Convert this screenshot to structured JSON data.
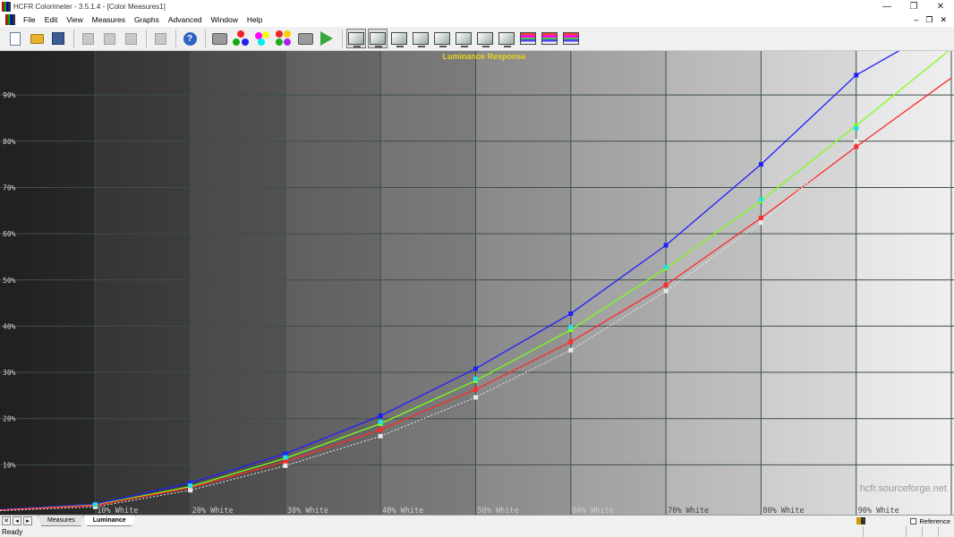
{
  "window": {
    "title": "HCFR Colorimeter - 3.5.1.4 - [Color Measures1]",
    "controls": {
      "minimize": "—",
      "restore": "❐",
      "close": "✕"
    }
  },
  "menu": {
    "items": [
      "File",
      "Edit",
      "View",
      "Measures",
      "Graphs",
      "Advanced",
      "Window",
      "Help"
    ],
    "mdi": {
      "minimize": "–",
      "restore": "❐",
      "close": "✕"
    }
  },
  "toolbar": {
    "help_glyph": "?"
  },
  "chart_data": {
    "type": "line",
    "title": "Luminance Response",
    "x": [
      0,
      10,
      20,
      30,
      40,
      50,
      60,
      70,
      80,
      90,
      100
    ],
    "xlim": [
      0,
      100
    ],
    "ylim": [
      0,
      100
    ],
    "x_tick_labels": [
      "10% White",
      "20% White",
      "30% White",
      "40% White",
      "50% White",
      "60% White",
      "70% White",
      "80% White",
      "90% White"
    ],
    "y_tick_labels": [
      "10%",
      "20%",
      "30%",
      "40%",
      "50%",
      "60%",
      "70%",
      "80%",
      "90%"
    ],
    "grid": true,
    "series": [
      {
        "color": "#1f1fff",
        "values": [
          0.3,
          1.5,
          6.1,
          12.4,
          20.6,
          30.8,
          42.7,
          57.5,
          75.0,
          94.3,
          106.0
        ]
      },
      {
        "color": "#7cff1a",
        "values": [
          0.2,
          1.3,
          5.3,
          11.4,
          18.9,
          28.2,
          39.2,
          52.5,
          67.1,
          83.4,
          100.0
        ]
      },
      {
        "color": "#ff2a2a",
        "values": [
          0.2,
          1.2,
          5.0,
          10.7,
          17.6,
          26.3,
          36.6,
          48.9,
          63.4,
          78.8,
          93.7
        ]
      },
      {
        "color": "#e8e8e8",
        "values": [
          0.1,
          0.9,
          4.5,
          9.8,
          16.2,
          24.6,
          34.8,
          47.6,
          62.4,
          80.0,
          100.0
        ]
      }
    ],
    "cyan_markers": {
      "color": "#22e0e8",
      "values": [
        0.2,
        1.4,
        5.5,
        11.6,
        19.3,
        28.6,
        39.8,
        52.8,
        67.4,
        82.8,
        100.0
      ]
    },
    "watermark": "hcfr.sourceforge.net"
  },
  "tabs": [
    {
      "label": "Measures",
      "active": false
    },
    {
      "label": "Luminance",
      "active": true
    }
  ],
  "tab_nav": {
    "close": "✕",
    "prev": "◂",
    "next": "▸"
  },
  "reference": {
    "label": "Reference",
    "checked": false
  },
  "status": {
    "text": "Ready"
  }
}
